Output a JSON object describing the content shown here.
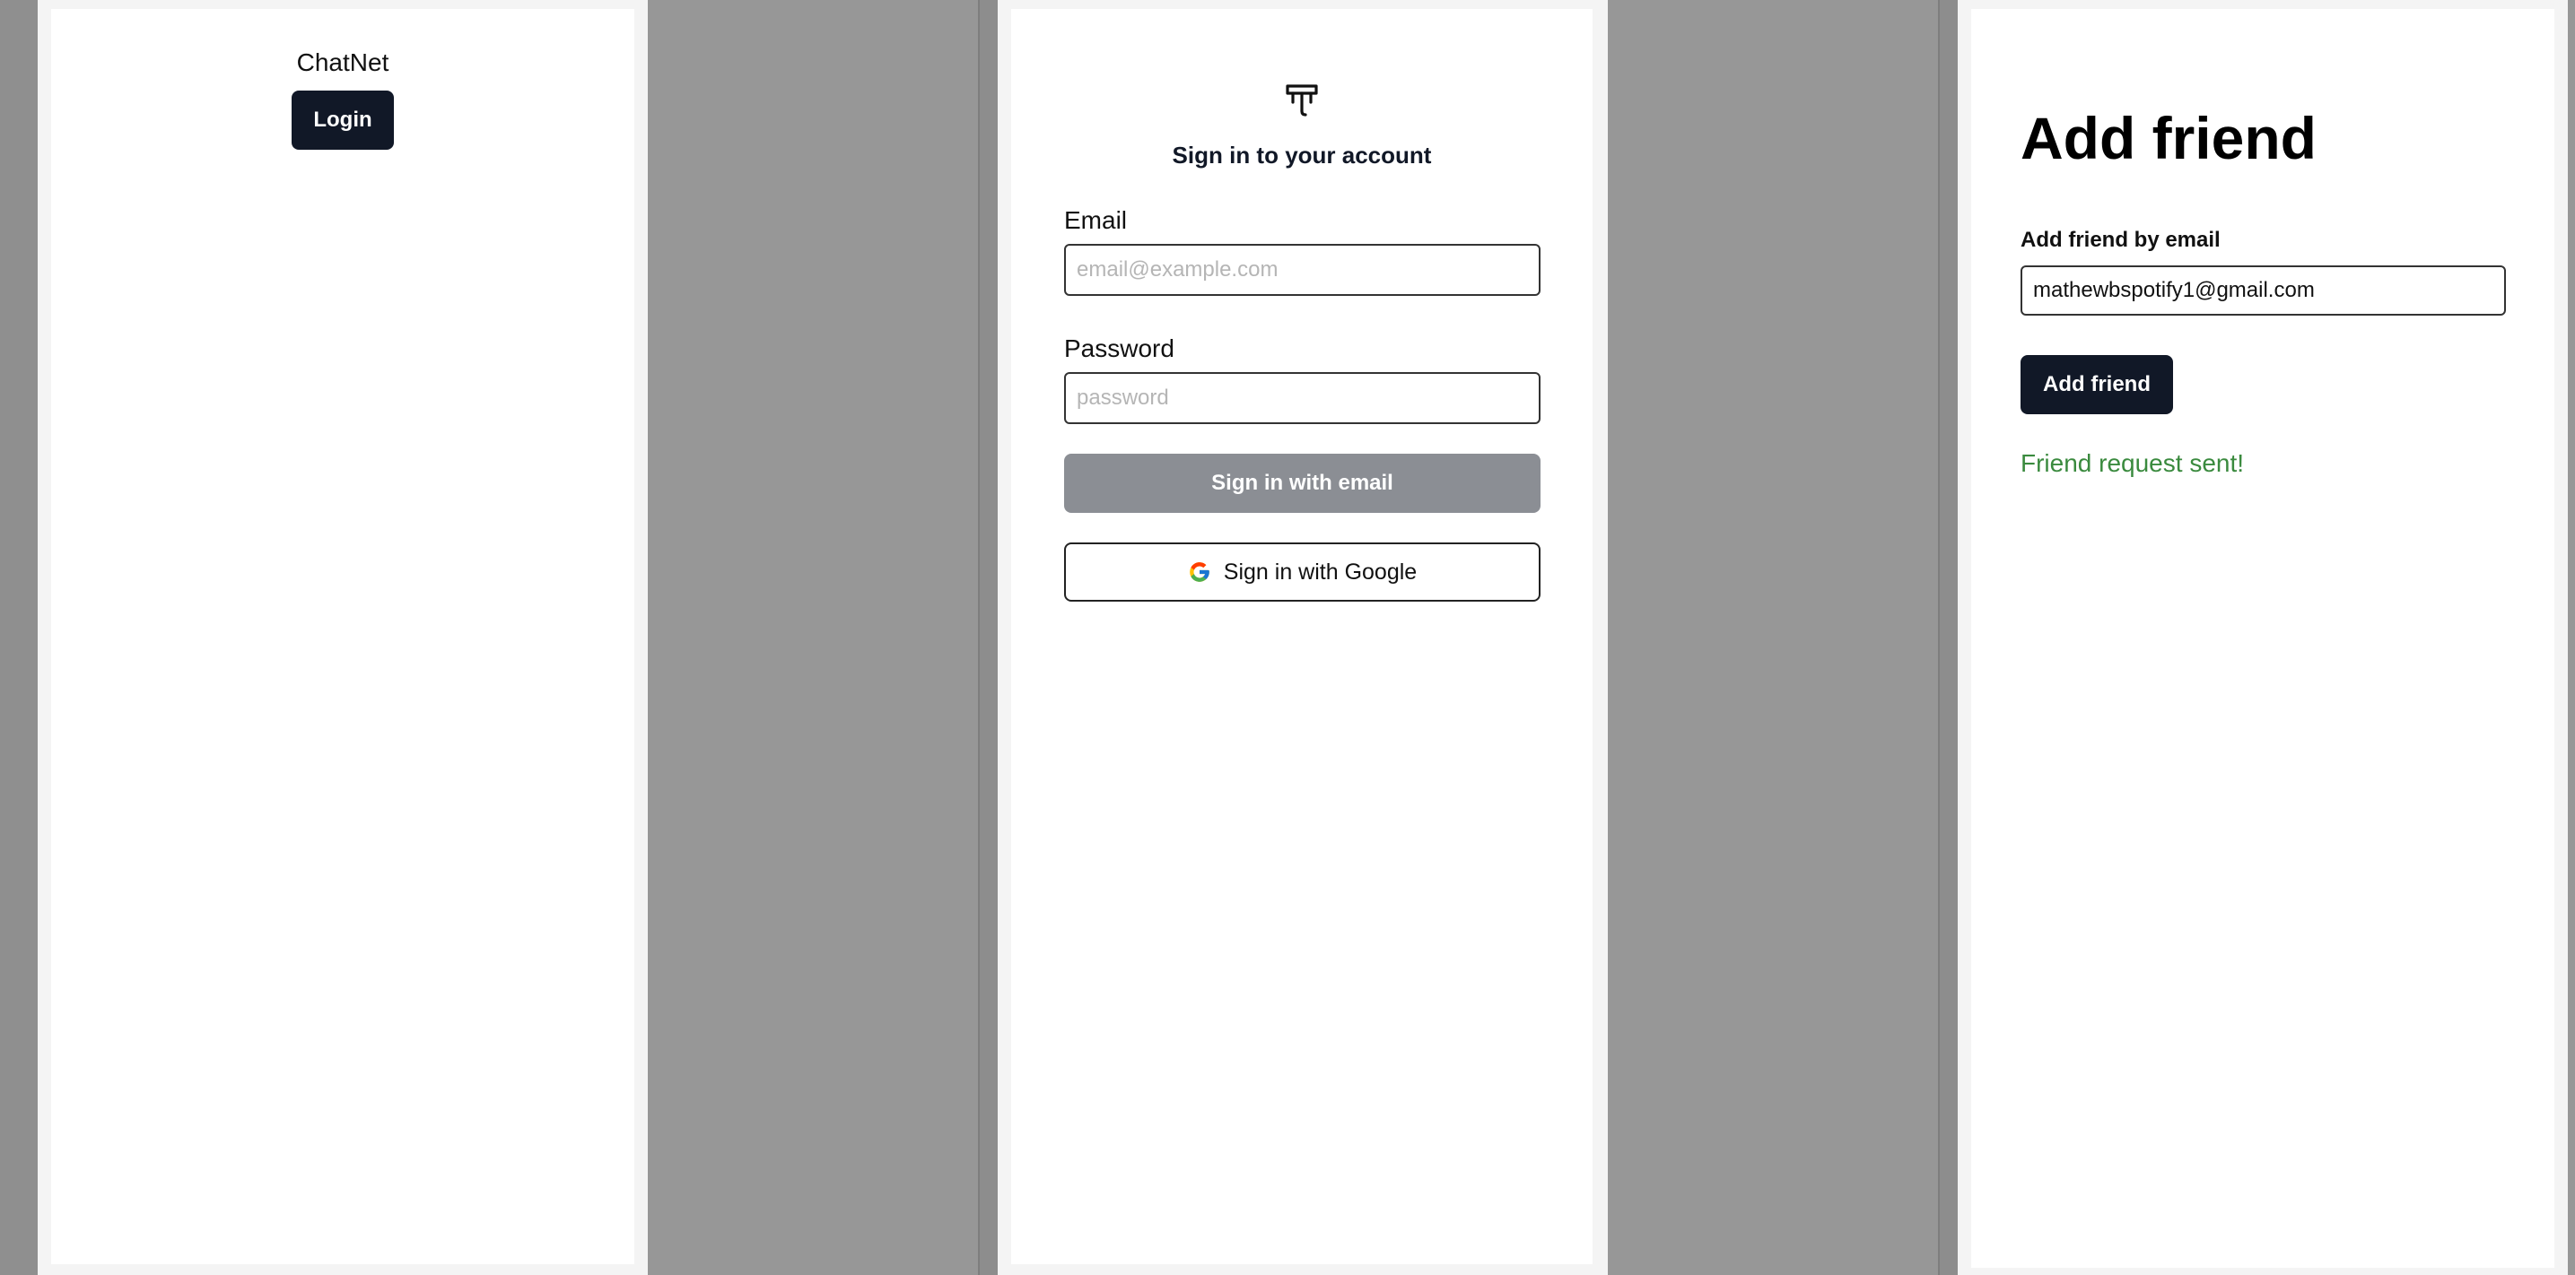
{
  "panel_home": {
    "brand": "ChatNet",
    "login_label": "Login"
  },
  "panel_signin": {
    "logo_icon": "antenna-icon",
    "title": "Sign in to your account",
    "email_label": "Email",
    "email_placeholder": "email@example.com",
    "password_label": "Password",
    "password_placeholder": "password",
    "email_signin_label": "Sign in with email",
    "google_icon": "google-icon",
    "google_signin_label": "Sign in with Google"
  },
  "panel_add_friend": {
    "title": "Add friend",
    "field_label": "Add friend by email",
    "email_value": "mathewbspotify1@gmail.com",
    "button_label": "Add friend",
    "status_message": "Friend request sent!"
  },
  "colors": {
    "background": "#979797",
    "primary_button": "#111827",
    "disabled_button": "#8b8e94",
    "success_text": "#3a8a3e"
  }
}
